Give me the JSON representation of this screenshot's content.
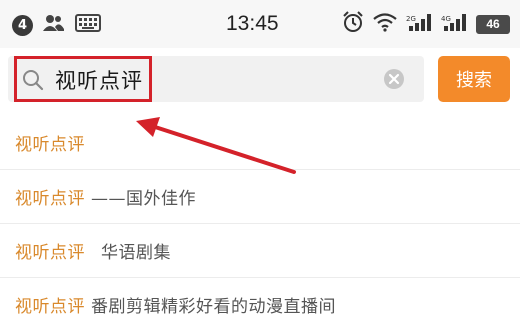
{
  "status_bar": {
    "notification_count": "4",
    "time": "13:45",
    "battery": "46",
    "icons": [
      "notification-badge",
      "contacts-icon",
      "keyboard-icon",
      "alarm-icon",
      "wifi-icon",
      "signal-icon",
      "signal-icon",
      "battery-icon"
    ]
  },
  "search": {
    "value": "视听点评",
    "clear_icon": "clear-icon",
    "button_label": "搜索"
  },
  "colors": {
    "accent": "#f38a2a",
    "keyword": "#d9892c",
    "annotation": "#d4222a"
  },
  "suggestions": [
    {
      "keyword": "视听点评",
      "rest": ""
    },
    {
      "keyword": "视听点评",
      "rest": "——国外佳作"
    },
    {
      "keyword": "视听点评",
      "rest": "华语剧集"
    },
    {
      "keyword": "视听点评",
      "rest": "番剧剪辑精彩好看的动漫直播间"
    }
  ]
}
